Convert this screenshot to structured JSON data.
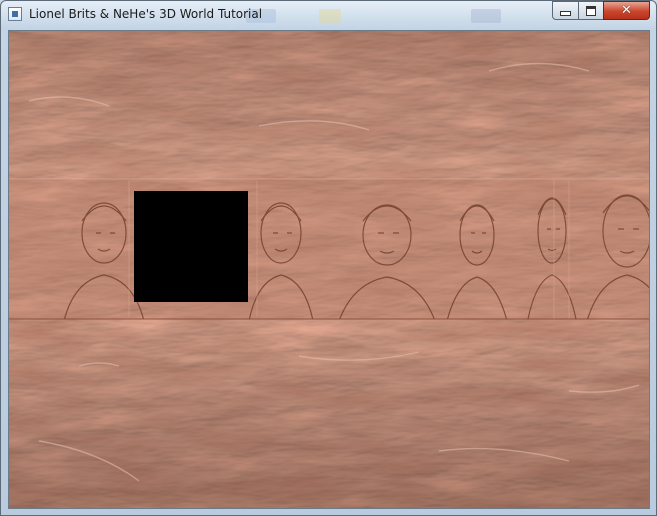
{
  "window": {
    "title": "Lionel Brits & NeHe's 3D World Tutorial",
    "icon": "app-icon",
    "controls": [
      "minimize-icon",
      "maximize-icon",
      "close-icon"
    ]
  },
  "scene": {
    "texture_color": "#a5624d",
    "wall_color": "#b0735c",
    "opening_color": "#000000"
  }
}
